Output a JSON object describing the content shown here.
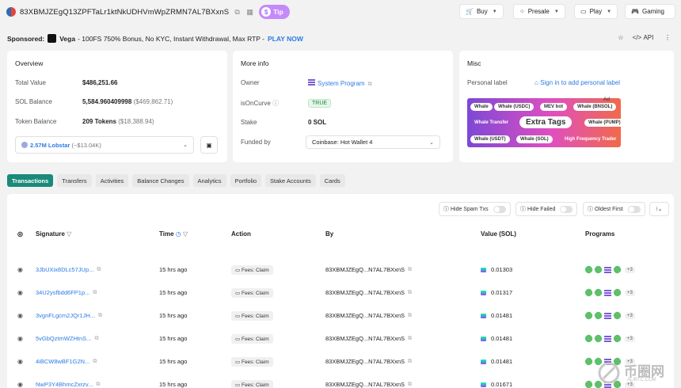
{
  "header": {
    "address": "83XBMJZEgQ13ZPFTaLr1ktNkUDHVmWpZRMN7AL7BXxnS",
    "tip_label": "Tip",
    "nav": [
      {
        "label": "Buy",
        "icon": "cart-icon"
      },
      {
        "label": "Presale",
        "icon": "grid-icon"
      },
      {
        "label": "Play",
        "icon": "monitor-icon"
      },
      {
        "label": "Gaming",
        "icon": "gamepad-icon"
      }
    ]
  },
  "sponsor": {
    "prefix": "Sponsored:",
    "brand": "Vega",
    "text": "- 100FS 750% Bonus, No KYC, Instant Withdrawal, Max RTP -",
    "cta": "PLAY NOW",
    "api_label": "API"
  },
  "overview": {
    "title": "Overview",
    "total_value_label": "Total Value",
    "total_value": "$486,251.66",
    "sol_balance_label": "SOL Balance",
    "sol_balance": "5,584.960409998",
    "sol_balance_usd": "($469,862.71)",
    "token_balance_label": "Token Balance",
    "token_balance": "209 Tokens",
    "token_balance_usd": "($18,388.94)",
    "token_select": "2.57M Lobstar",
    "token_select_usd": "(~$13.04K)"
  },
  "more_info": {
    "title": "More info",
    "owner_label": "Owner",
    "owner": "System Program",
    "oncurve_label": "isOnCurve",
    "oncurve": "TRUE",
    "stake_label": "Stake",
    "stake": "0 SOL",
    "funded_label": "Funded by",
    "funded": "Coinbase: Hot Wallet 4"
  },
  "misc": {
    "title": "Misc",
    "personal_label": "Personal label",
    "sign_in": "Sign in to add personal label",
    "ad_label": "Ad",
    "ad_tags": [
      "Whale",
      "Whale (USDC)",
      "MEV bot",
      "Whale (BNSOL)",
      "Whale Transfer",
      "Extra Tags",
      "Whale (PUMP)",
      "Whale (USDT)",
      "Whale (SOL)",
      "High Frequency Trader"
    ]
  },
  "tabs": [
    "Transactions",
    "Transfers",
    "Activities",
    "Balance Changes",
    "Analytics",
    "Portfolio",
    "Stake Accounts",
    "Cards"
  ],
  "filters": {
    "hide_spam": "Hide Spam Txs",
    "hide_failed": "Hide Failed",
    "oldest_first": "Oldest First"
  },
  "table": {
    "columns": {
      "signature": "Signature",
      "time": "Time",
      "action": "Action",
      "by": "By",
      "value": "Value (SOL)",
      "programs": "Programs"
    },
    "rows": [
      {
        "signature": "3JbUXix8DLc57JUp...",
        "time": "15 hrs ago",
        "action": "Fees: Claim",
        "by": "83XBMJZEgQ...N7AL7BXxnS",
        "value": "0.01303",
        "extra": "+3"
      },
      {
        "signature": "34U2ysfbdd6FP1p...",
        "time": "15 hrs ago",
        "action": "Fees: Claim",
        "by": "83XBMJZEgQ...N7AL7BXxnS",
        "value": "0.01317",
        "extra": "+3"
      },
      {
        "signature": "3vgnFLgcm2JQr1JH...",
        "time": "15 hrs ago",
        "action": "Fees: Claim",
        "by": "83XBMJZEgQ...N7AL7BXxnS",
        "value": "0.01481",
        "extra": "+3"
      },
      {
        "signature": "5vGbQztmWZHtnS...",
        "time": "15 hrs ago",
        "action": "Fees: Claim",
        "by": "83XBMJZEgQ...N7AL7BXxnS",
        "value": "0.01481",
        "extra": "+3"
      },
      {
        "signature": "4iBCW8wBF1G2N...",
        "time": "15 hrs ago",
        "action": "Fees: Claim",
        "by": "83XBMJZEgQ...N7AL7BXxnS",
        "value": "0.01481",
        "extra": "+3"
      },
      {
        "signature": "NwP3Y4BhmcZxrzv...",
        "time": "15 hrs ago",
        "action": "Fees: Claim",
        "by": "83XBMJZEgQ...N7AL7BXxnS",
        "value": "0.01671",
        "extra": "+3"
      }
    ]
  },
  "watermark": {
    "cn": "币圈网",
    "domain": "ALIBTC.COM"
  }
}
